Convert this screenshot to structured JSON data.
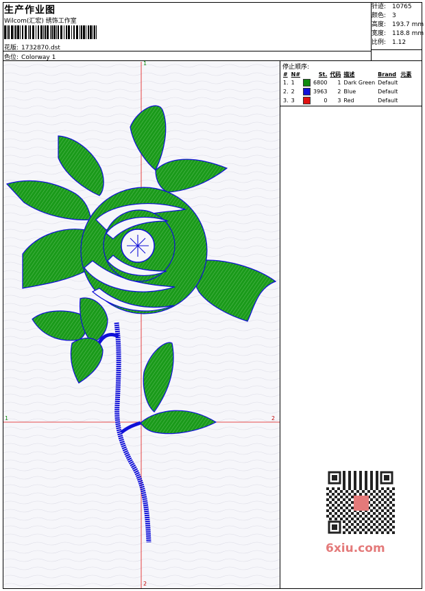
{
  "header": {
    "title": "生产作业图",
    "studio": "Wilcom(汇宏) 绣饰工作室",
    "design_label": "花版:",
    "design_file": "1732870.dst",
    "colorway_label": "色位:",
    "colorway": "Colorway 1"
  },
  "stats": [
    {
      "label": "针迹:",
      "value": "10765"
    },
    {
      "label": "颜色:",
      "value": "3"
    },
    {
      "label": "高度:",
      "value": "193.7 mm"
    },
    {
      "label": "宽度:",
      "value": "118.8 mm"
    },
    {
      "label": "比例:",
      "value": "1.12"
    }
  ],
  "stop_sequence": {
    "title": "停止顺序:",
    "columns": [
      "#",
      "N#",
      "St.",
      "代码",
      "描述",
      "Brand",
      "元素"
    ],
    "rows": [
      {
        "idx": "1.",
        "n": "1",
        "color": "#0f8a0f",
        "stitches": "6800",
        "code": "1",
        "desc": "Dark Green",
        "brand": "Default"
      },
      {
        "idx": "2.",
        "n": "2",
        "color": "#1010d8",
        "stitches": "3963",
        "code": "2",
        "desc": "Blue",
        "brand": "Default"
      },
      {
        "idx": "3.",
        "n": "3",
        "color": "#e01010",
        "stitches": "0",
        "code": "3",
        "desc": "Red",
        "brand": "Default"
      }
    ]
  },
  "axis_labels": {
    "top": "1",
    "bottom": "2",
    "left": "1",
    "right": "2"
  },
  "watermark": "6xiu.com",
  "colors": {
    "green": "#1a9a1a",
    "blue": "#1010d8",
    "red": "#e01010"
  }
}
